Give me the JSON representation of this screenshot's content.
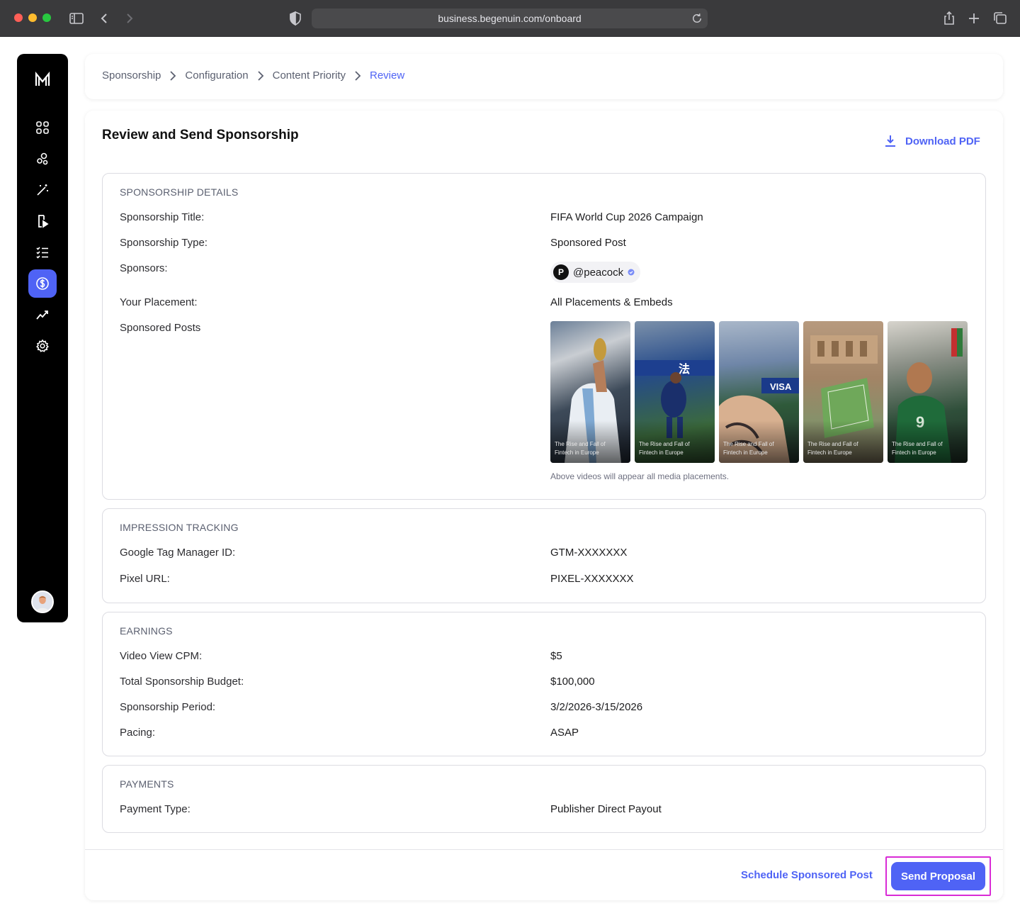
{
  "browser": {
    "url": "business.begenuin.com/onboard"
  },
  "breadcrumb": [
    {
      "label": "Sponsorship"
    },
    {
      "label": "Configuration"
    },
    {
      "label": "Content Priority"
    },
    {
      "label": "Review"
    }
  ],
  "page": {
    "title": "Review and Send Sponsorship",
    "download_label": "Download PDF"
  },
  "sponsorship_details": {
    "heading": "SPONSORSHIP DETAILS",
    "title_label": "Sponsorship Title:",
    "title_value": "FIFA World Cup 2026 Campaign",
    "type_label": "Sponsorship Type:",
    "type_value": "Sponsored Post",
    "sponsors_label": "Sponsors:",
    "sponsor_logo": "P",
    "sponsor_handle": "@peacock",
    "placement_label": "Your Placement:",
    "placement_value": "All Placements & Embeds",
    "posts_label": "Sponsored Posts",
    "posts": [
      {
        "caption": "The Rise and Fall of Fintech in Europe"
      },
      {
        "caption": "The Rise and Fall of Fintech in Europe"
      },
      {
        "caption": "The Rise and Fall of Fintech in Europe"
      },
      {
        "caption": "The Rise and Fall of Fintech in Europe"
      },
      {
        "caption": "The Rise and Fall of Fintech in Europe"
      }
    ],
    "posts_note": "Above videos will appear all media placements."
  },
  "impression_tracking": {
    "heading": "IMPRESSION TRACKING",
    "gtm_label": "Google Tag Manager ID:",
    "gtm_value": "GTM-XXXXXXX",
    "pixel_label": "Pixel URL:",
    "pixel_value": "PIXEL-XXXXXXX"
  },
  "earnings": {
    "heading": "EARNINGS",
    "cpm_label": "Video View CPM:",
    "cpm_value": "$5",
    "budget_label": "Total Sponsorship Budget:",
    "budget_value": "$100,000",
    "period_label": "Sponsorship Period:",
    "period_value": "3/2/2026-3/15/2026",
    "pacing_label": "Pacing:",
    "pacing_value": "ASAP"
  },
  "payments": {
    "heading": "PAYMENTS",
    "type_label": "Payment Type:",
    "type_value": "Publisher Direct Payout"
  },
  "actions": {
    "schedule_label": "Schedule Sponsored Post",
    "send_label": "Send Proposal"
  },
  "colors": {
    "accent": "#4f63f5",
    "highlight": "#d92bd6"
  }
}
